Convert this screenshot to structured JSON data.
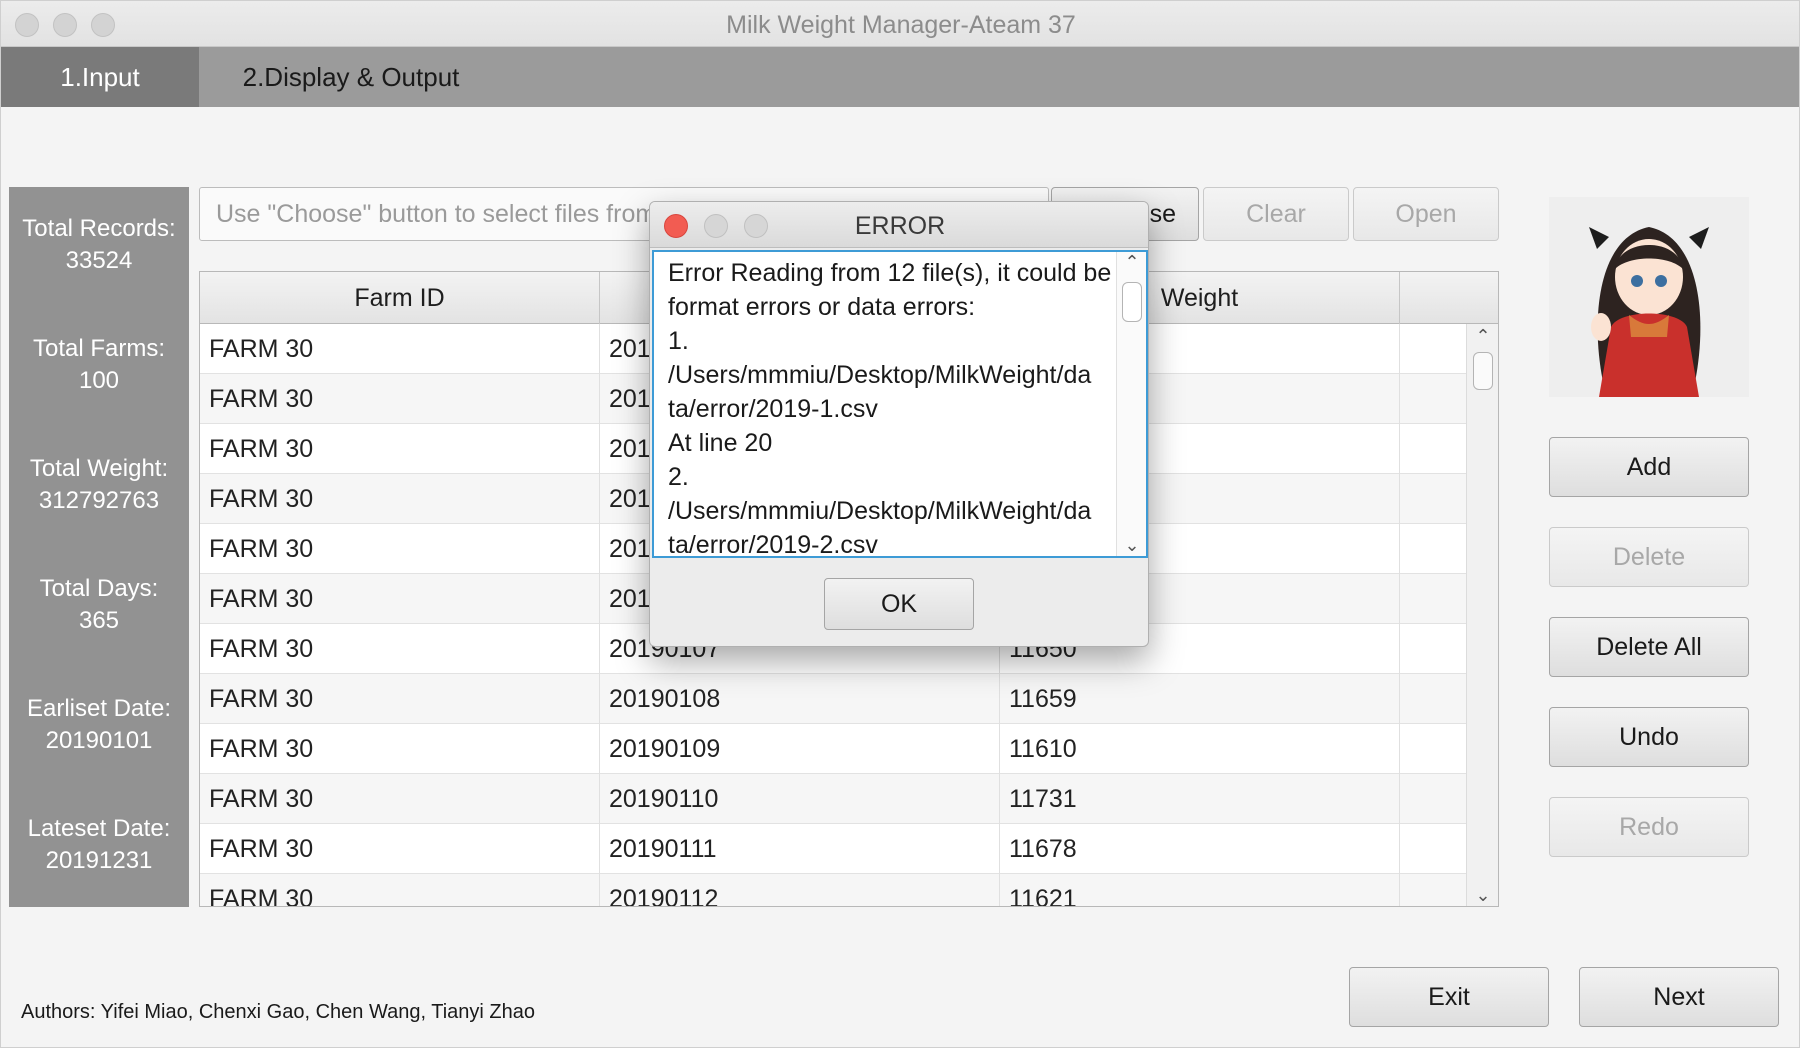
{
  "window": {
    "title": "Milk Weight Manager-Ateam 37"
  },
  "tabs": [
    {
      "label": "1.Input",
      "active": true
    },
    {
      "label": "2.Display & Output",
      "active": false
    }
  ],
  "stats": [
    {
      "label": "Total Records:",
      "value": "33524"
    },
    {
      "label": "Total Farms:",
      "value": "100"
    },
    {
      "label": "Total Weight:",
      "value": "312792763"
    },
    {
      "label": "Total Days:",
      "value": "365"
    },
    {
      "label": "Earliset Date:",
      "value": "20190101"
    },
    {
      "label": "Lateset Date:",
      "value": "20191231"
    }
  ],
  "file_input": {
    "placeholder": "Use \"Choose\" button to select files from",
    "value": ""
  },
  "file_buttons": {
    "choose_visible": "se",
    "clear": "Clear",
    "open": "Open"
  },
  "table": {
    "columns": [
      "Farm ID",
      "",
      "Weight"
    ],
    "rows": [
      [
        "FARM 30",
        "201",
        ""
      ],
      [
        "FARM 30",
        "201",
        ""
      ],
      [
        "FARM 30",
        "201",
        ""
      ],
      [
        "FARM 30",
        "201",
        ""
      ],
      [
        "FARM 30",
        "201",
        ""
      ],
      [
        "FARM 30",
        "201",
        ""
      ],
      [
        "FARM 30",
        "20190107",
        "11650"
      ],
      [
        "FARM 30",
        "20190108",
        "11659"
      ],
      [
        "FARM 30",
        "20190109",
        "11610"
      ],
      [
        "FARM 30",
        "20190110",
        "11731"
      ],
      [
        "FARM 30",
        "20190111",
        "11678"
      ],
      [
        "FARM 30",
        "20190112",
        "11621"
      ]
    ]
  },
  "side_buttons": {
    "add": "Add",
    "delete": "Delete",
    "delete_all": "Delete All",
    "undo": "Undo",
    "redo": "Redo"
  },
  "footer": {
    "authors": "Authors: Yifei Miao, Chenxi Gao, Chen Wang, Tianyi Zhao",
    "exit": "Exit",
    "next": "Next"
  },
  "error_dialog": {
    "title": "ERROR",
    "lines": [
      "Error Reading from 12 file(s), it could be",
      "format errors or data errors:",
      "1.",
      "/Users/mmmiu/Desktop/MilkWeight/da",
      "ta/error/2019-1.csv",
      "At line 20",
      "2.",
      "/Users/mmmiu/Desktop/MilkWeight/da",
      "ta/error/2019-2.csv"
    ],
    "ok": "OK"
  },
  "colors": {
    "tab_bar": "#9b9b9b",
    "tab_active": "#7a7a7a",
    "stats_panel": "#929292",
    "dialog_focus": "#3d9bd6",
    "close_light": "#f25c52"
  },
  "icons": [
    "avatar-illustration",
    "scroll-up-arrow-icon",
    "scroll-down-arrow-icon"
  ]
}
